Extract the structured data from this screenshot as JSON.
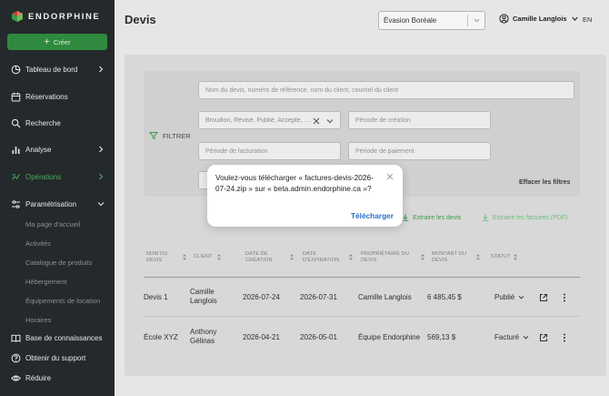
{
  "sidebar": {
    "brand": "ENDORPHINE",
    "create_label": "Créer",
    "items": [
      {
        "label": "Tableau de bord"
      },
      {
        "label": "Réservations"
      },
      {
        "label": "Recherche"
      },
      {
        "label": "Analyse"
      },
      {
        "label": "Opérations"
      },
      {
        "label": "Paramétrisation"
      }
    ],
    "subitems": [
      {
        "label": "Ma page d'accueil"
      },
      {
        "label": "Activités"
      },
      {
        "label": "Catalogue de produits"
      },
      {
        "label": "Hébergement"
      },
      {
        "label": "Équipements de location"
      },
      {
        "label": "Horaires"
      }
    ],
    "bottom": [
      {
        "label": "Base de connaissances"
      },
      {
        "label": "Obtenir du support"
      },
      {
        "label": "Réduire"
      }
    ],
    "colors": {
      "background": "#24292b",
      "active": "#4eaa5e",
      "create": "#2f8a3f"
    }
  },
  "header": {
    "title": "Devis",
    "organization": "Évasion Boréale",
    "user": "Camille Langlois",
    "language": "EN"
  },
  "filters": {
    "label": "FILTRER",
    "search_placeholder": "Nom du devis, numéro de référence, nom du client, courriel du client",
    "status_value": "Brouillon, Révisé, Publié, Accepté, Fa...",
    "creation_period": "Période de création",
    "billing_period": "Période de facturation",
    "payment_period": "Période de paiement",
    "clear": "Effacer les filtres"
  },
  "actions": {
    "extract_quotes": "Extraire les devis",
    "extract_invoices": "Extraire les factures (PDF)"
  },
  "table": {
    "columns": [
      {
        "label": "Nom du devis"
      },
      {
        "label": "Client"
      },
      {
        "label": "Date de création"
      },
      {
        "label": "Date d'expiration"
      },
      {
        "label": "Propriétaire du devis"
      },
      {
        "label": "Montant du devis"
      },
      {
        "label": "Statut"
      }
    ],
    "rows": [
      {
        "name": "Devis 1",
        "client": "Camille Langlois",
        "created": "2026-07-24",
        "expires": "2026-07-31",
        "owner": "Camille Langlois",
        "amount": "6 485,45 $",
        "status": "Publié"
      },
      {
        "name": "École XYZ",
        "client": "Anthony Gélinas",
        "created": "2026-04-21",
        "expires": "2026-05-01",
        "owner": "Équipe Endorphine",
        "amount": "569,13 $",
        "status": "Facturé"
      }
    ]
  },
  "dialog": {
    "message": "Voulez-vous télécharger « factures-devis-2026-07-24.zip » sur « beta.admin.endorphine.ca »?",
    "button": "Télécharger"
  }
}
